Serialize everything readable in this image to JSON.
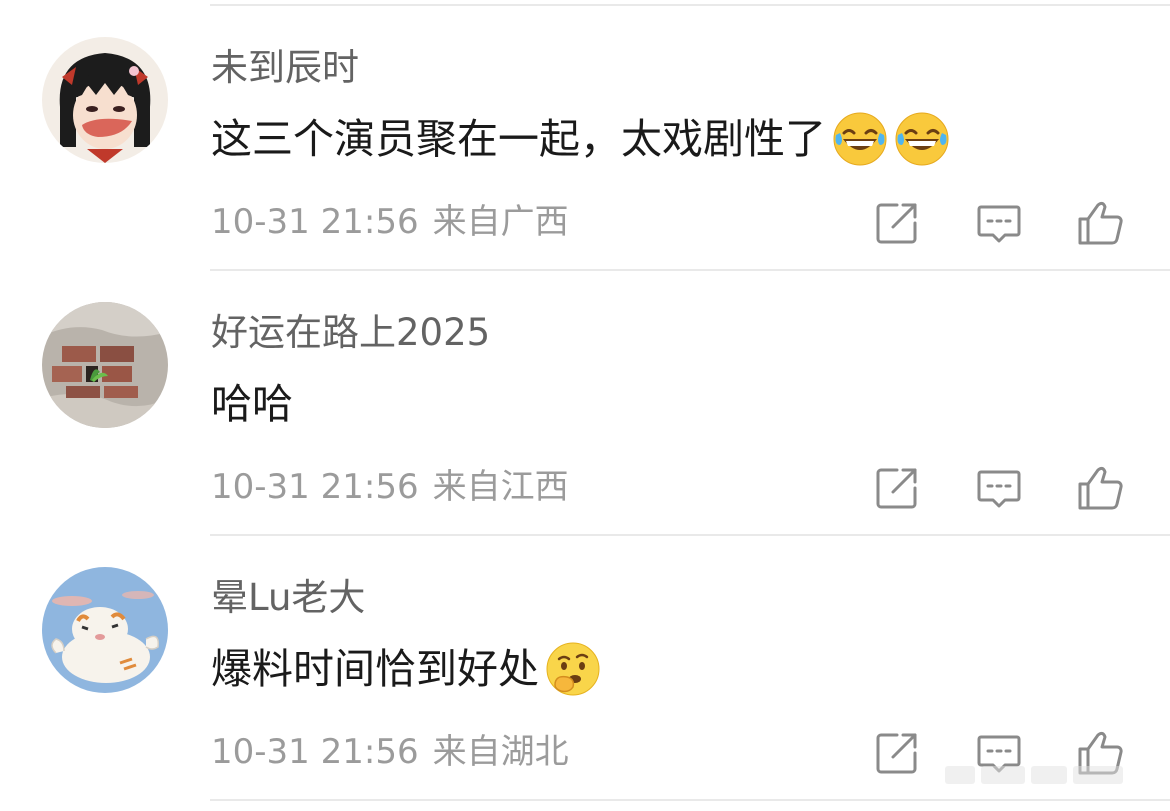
{
  "comments": [
    {
      "username": "未到辰时",
      "text": "这三个演员聚在一起，太戏剧性了",
      "emojis": [
        "grin-sweat-emoji",
        "grin-sweat-emoji"
      ],
      "date": "10-31 21:56",
      "location": "来自广西"
    },
    {
      "username": "好运在路上2025",
      "text": "哈哈",
      "emojis": [],
      "date": "10-31 21:56",
      "location": "来自江西"
    },
    {
      "username": "晕Lu老大",
      "text": "爆料时间恰到好处",
      "emojis": [
        "thinking-emoji"
      ],
      "date": "10-31 21:56",
      "location": "来自湖北"
    }
  ],
  "icons": {
    "share": "share-icon",
    "reply": "comment-icon",
    "like": "thumbs-up-icon"
  },
  "colors": {
    "username": "#636363",
    "content": "#1a1a1a",
    "meta": "#9b9b9b",
    "divider": "#e9e9e9",
    "action_icon": "#8a8a8a"
  }
}
